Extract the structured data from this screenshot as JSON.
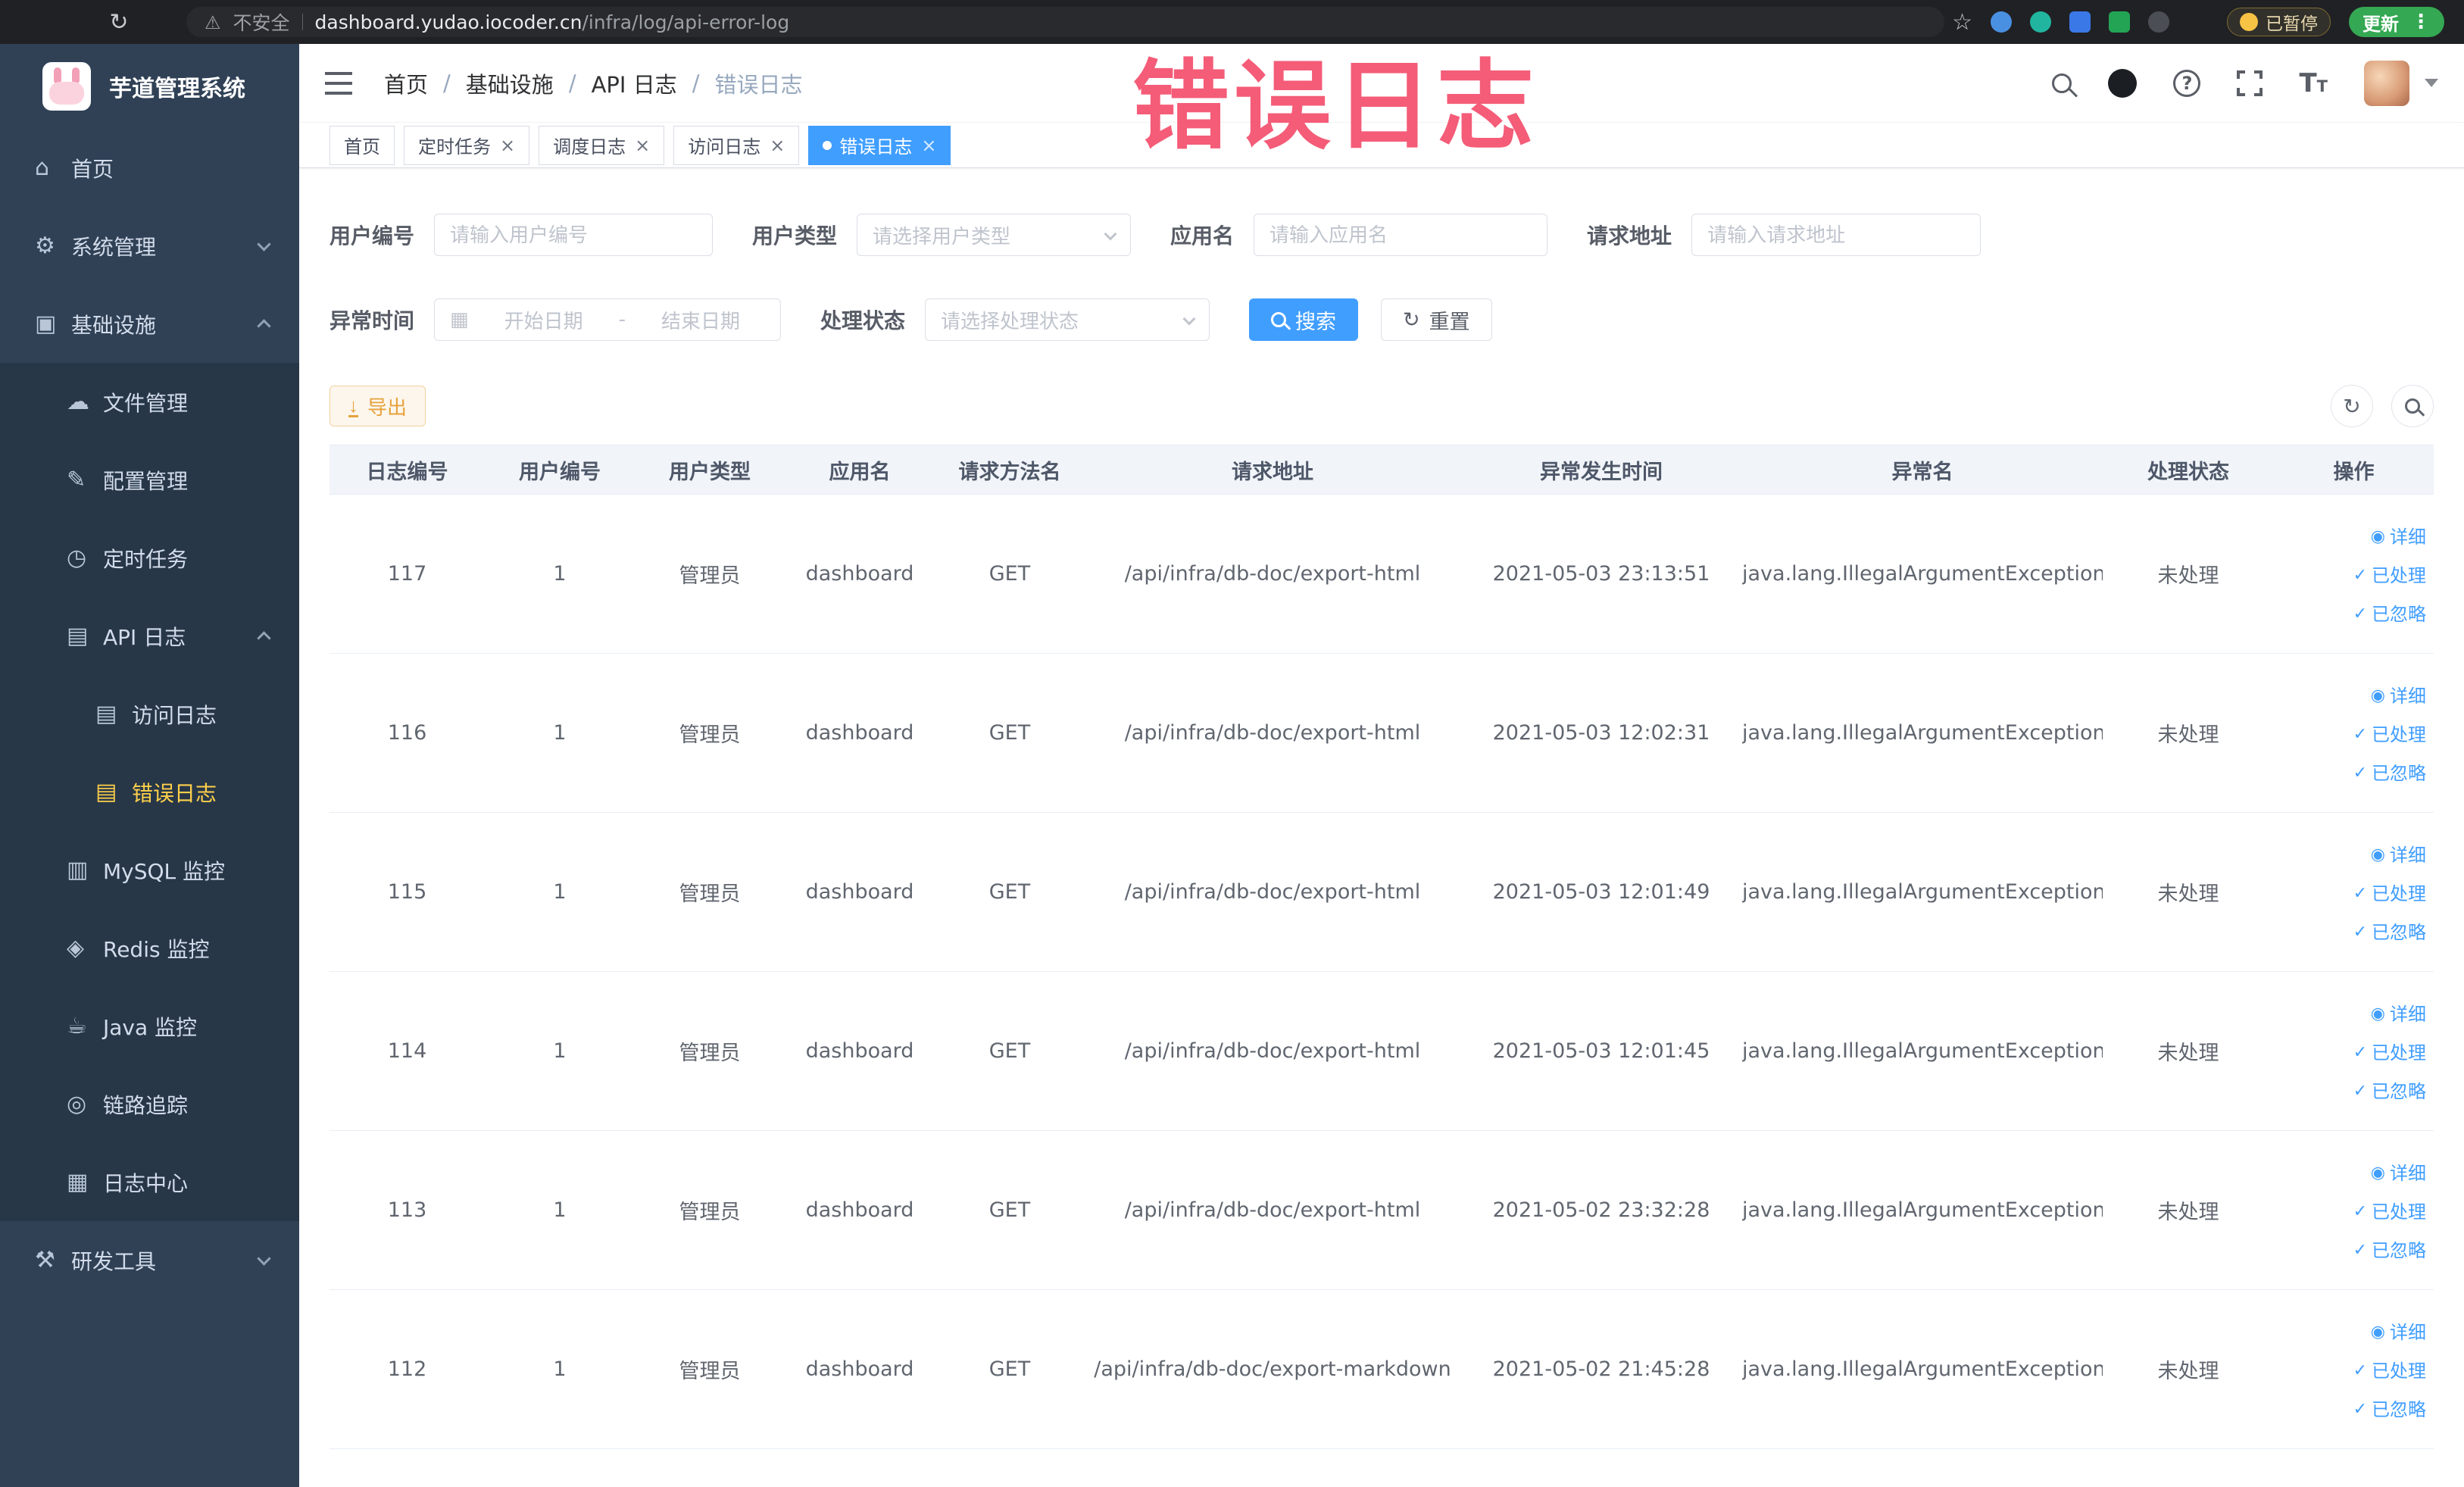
{
  "colors": {
    "accent": "#409eff",
    "active": "#ffd04b",
    "watermark": "#f4506e",
    "warning": "#e6a23c"
  },
  "watermark": {
    "text": "错误日志"
  },
  "browser": {
    "security_text": "不安全",
    "url_host": "dashboard.yudao.iocoder.cn",
    "url_path": "/infra/log/api-error-log",
    "paused_badge": "已暂停",
    "update_badge": "更新"
  },
  "sidebar": {
    "title": "芋道管理系统",
    "items": [
      {
        "label": "首页",
        "icon": "home-icon",
        "level": 1
      },
      {
        "label": "系统管理",
        "icon": "gear-icon",
        "level": 1,
        "chevron": "down"
      },
      {
        "label": "基础设施",
        "icon": "infra-icon",
        "level": 1,
        "chevron": "up"
      },
      {
        "label": "文件管理",
        "icon": "file-icon",
        "level": 2
      },
      {
        "label": "配置管理",
        "icon": "config-icon",
        "level": 2
      },
      {
        "label": "定时任务",
        "icon": "timer-icon",
        "level": 2
      },
      {
        "label": "API 日志",
        "icon": "api-log-icon",
        "level": 2,
        "chevron": "up"
      },
      {
        "label": "访问日志",
        "icon": "access-log-icon",
        "level": 3
      },
      {
        "label": "错误日志",
        "icon": "error-log-icon",
        "level": 3,
        "active": true
      },
      {
        "label": "MySQL 监控",
        "icon": "mysql-icon",
        "level": 2
      },
      {
        "label": "Redis 监控",
        "icon": "redis-icon",
        "level": 2
      },
      {
        "label": "Java 监控",
        "icon": "java-icon",
        "level": 2
      },
      {
        "label": "链路追踪",
        "icon": "trace-icon",
        "level": 2
      },
      {
        "label": "日志中心",
        "icon": "logcenter-icon",
        "level": 2
      },
      {
        "label": "研发工具",
        "icon": "tools-icon",
        "level": 1,
        "chevron": "down"
      }
    ]
  },
  "navbar": {
    "breadcrumb": [
      "首页",
      "基础设施",
      "API 日志",
      "错误日志"
    ]
  },
  "tags": [
    {
      "label": "首页",
      "closable": false,
      "active": false
    },
    {
      "label": "定时任务",
      "closable": true,
      "active": false
    },
    {
      "label": "调度日志",
      "closable": true,
      "active": false
    },
    {
      "label": "访问日志",
      "closable": true,
      "active": false
    },
    {
      "label": "错误日志",
      "closable": true,
      "active": true
    }
  ],
  "filters": {
    "user_id": {
      "label": "用户编号",
      "placeholder": "请输入用户编号"
    },
    "user_type": {
      "label": "用户类型",
      "placeholder": "请选择用户类型"
    },
    "app_name": {
      "label": "应用名",
      "placeholder": "请输入应用名"
    },
    "request_url": {
      "label": "请求地址",
      "placeholder": "请输入请求地址"
    },
    "exception_time": {
      "label": "异常时间",
      "start_placeholder": "开始日期",
      "separator": "-",
      "end_placeholder": "结束日期"
    },
    "process_status": {
      "label": "处理状态",
      "placeholder": "请选择处理状态"
    },
    "search_label": "搜索",
    "reset_label": "重置"
  },
  "toolbar": {
    "export_label": "导出"
  },
  "table": {
    "columns": [
      "日志编号",
      "用户编号",
      "用户类型",
      "应用名",
      "请求方法名",
      "请求地址",
      "异常发生时间",
      "异常名",
      "处理状态",
      "操作"
    ],
    "row_actions": [
      {
        "label": "详细",
        "icon": "eye-icon"
      },
      {
        "label": "已处理",
        "icon": "check-icon"
      },
      {
        "label": "已忽略",
        "icon": "check-icon"
      }
    ],
    "rows": [
      {
        "cells": [
          "117",
          "1",
          "管理员",
          "dashboard",
          "GET",
          "/api/infra/db-doc/export-html",
          "2021-05-03 23:13:51",
          "java.lang.IllegalArgumentException",
          "未处理"
        ]
      },
      {
        "cells": [
          "116",
          "1",
          "管理员",
          "dashboard",
          "GET",
          "/api/infra/db-doc/export-html",
          "2021-05-03 12:02:31",
          "java.lang.IllegalArgumentException",
          "未处理"
        ]
      },
      {
        "cells": [
          "115",
          "1",
          "管理员",
          "dashboard",
          "GET",
          "/api/infra/db-doc/export-html",
          "2021-05-03 12:01:49",
          "java.lang.IllegalArgumentException",
          "未处理"
        ]
      },
      {
        "cells": [
          "114",
          "1",
          "管理员",
          "dashboard",
          "GET",
          "/api/infra/db-doc/export-html",
          "2021-05-03 12:01:45",
          "java.lang.IllegalArgumentException",
          "未处理"
        ]
      },
      {
        "cells": [
          "113",
          "1",
          "管理员",
          "dashboard",
          "GET",
          "/api/infra/db-doc/export-html",
          "2021-05-02 23:32:28",
          "java.lang.IllegalArgumentException",
          "未处理"
        ]
      },
      {
        "cells": [
          "112",
          "1",
          "管理员",
          "dashboard",
          "GET",
          "/api/infra/db-doc/export-markdown",
          "2021-05-02 21:45:28",
          "java.lang.IllegalArgumentException",
          "未处理"
        ]
      }
    ]
  }
}
